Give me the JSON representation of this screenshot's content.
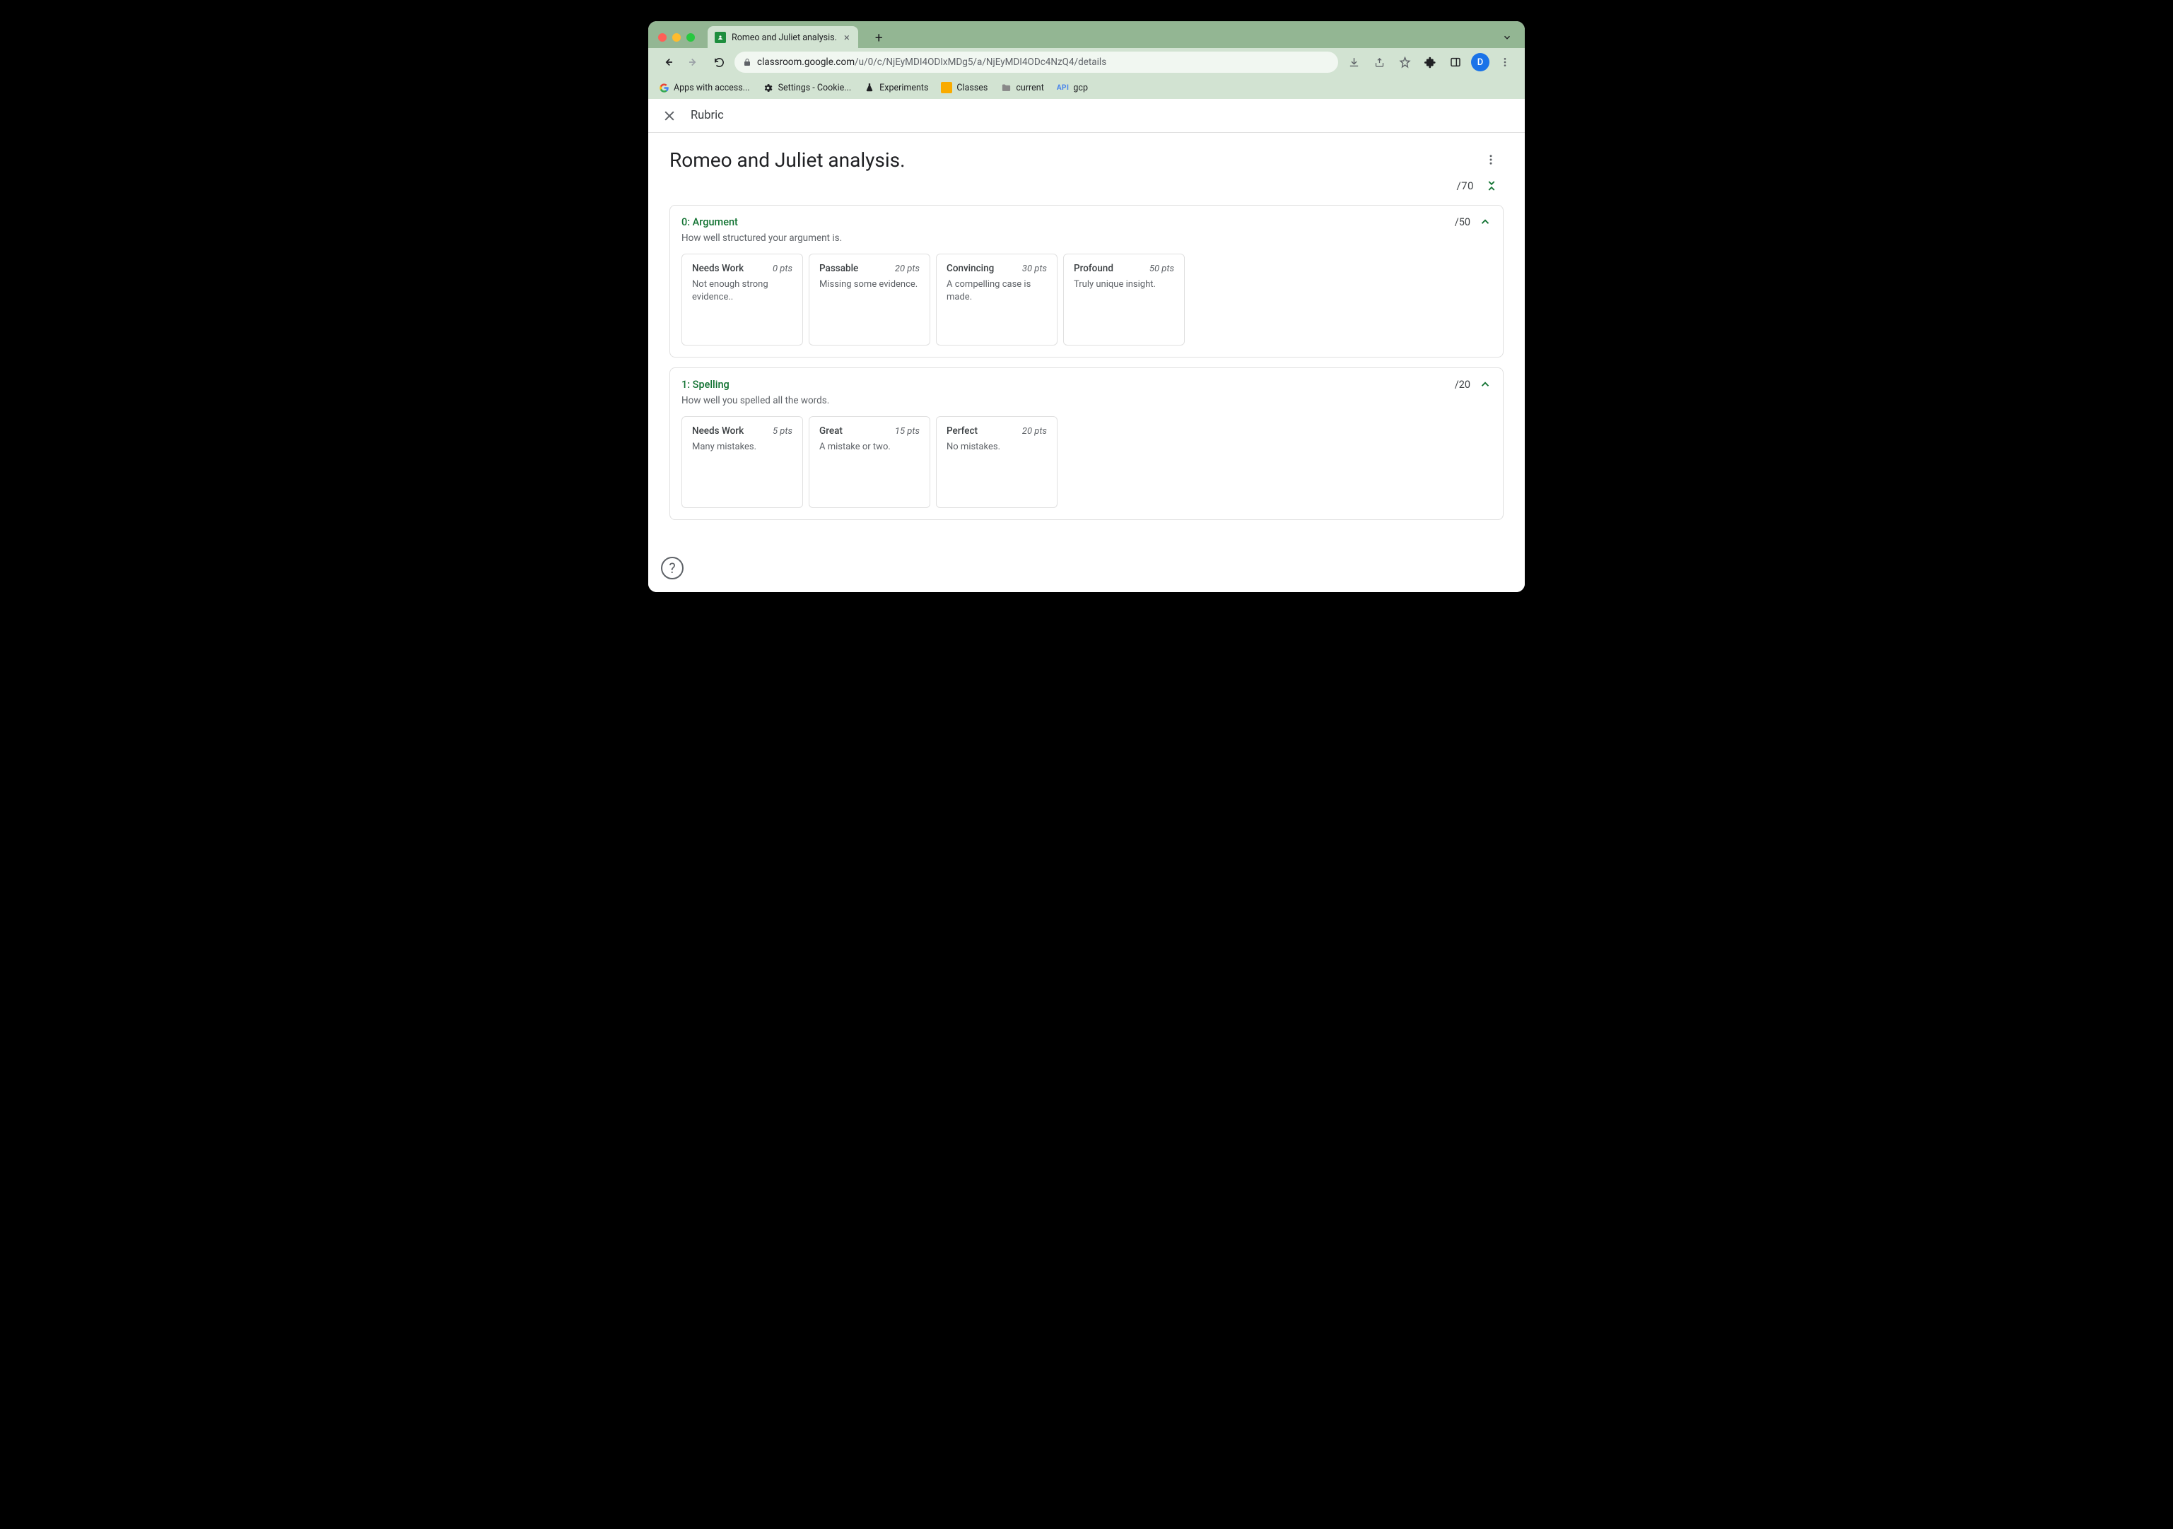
{
  "browser": {
    "tab_title": "Romeo and Juliet analysis.",
    "url_host": "classroom.google.com",
    "url_path": "/u/0/c/NjEyMDI4ODIxMDg5/a/NjEyMDI4ODc4NzQ4/details",
    "avatar_letter": "D",
    "bookmarks": [
      {
        "label": "Apps with access..."
      },
      {
        "label": "Settings - Cookie..."
      },
      {
        "label": "Experiments"
      },
      {
        "label": "Classes"
      },
      {
        "label": "current"
      },
      {
        "label": "API"
      },
      {
        "label": "gcp"
      }
    ]
  },
  "header": {
    "title": "Rubric"
  },
  "rubric": {
    "title": "Romeo and Juliet analysis.",
    "total_points": "/70",
    "criteria": [
      {
        "title": "0: Argument",
        "points": "/50",
        "description": "How well structured your argument is.",
        "levels": [
          {
            "name": "Needs Work",
            "pts": "0 pts",
            "desc": "Not enough strong evidence.."
          },
          {
            "name": "Passable",
            "pts": "20 pts",
            "desc": "Missing some evidence."
          },
          {
            "name": "Convincing",
            "pts": "30 pts",
            "desc": "A compelling case is made."
          },
          {
            "name": "Profound",
            "pts": "50 pts",
            "desc": "Truly unique insight."
          }
        ]
      },
      {
        "title": "1: Spelling",
        "points": "/20",
        "description": "How well you spelled all the words.",
        "levels": [
          {
            "name": "Needs Work",
            "pts": "5 pts",
            "desc": "Many mistakes."
          },
          {
            "name": "Great",
            "pts": "15 pts",
            "desc": "A mistake or two."
          },
          {
            "name": "Perfect",
            "pts": "20 pts",
            "desc": "No mistakes."
          }
        ]
      }
    ]
  }
}
